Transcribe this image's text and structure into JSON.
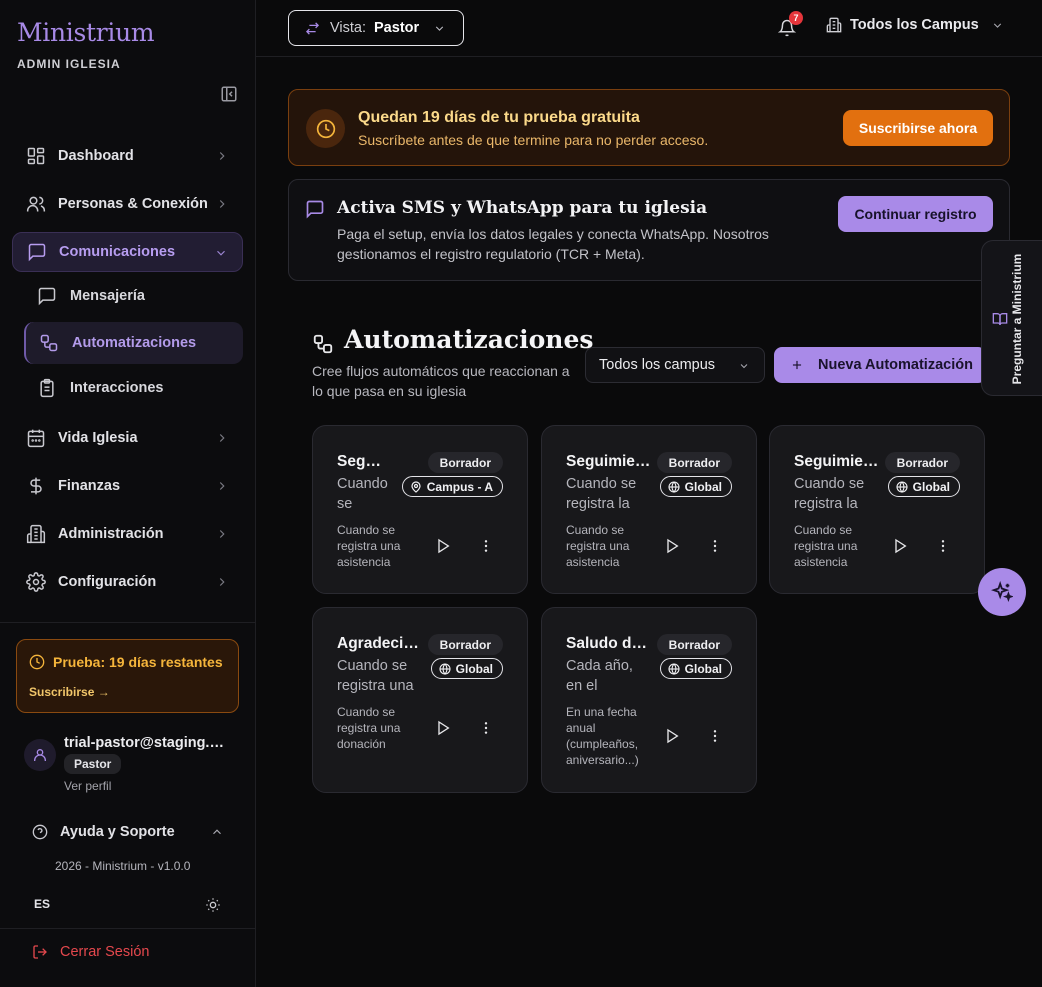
{
  "sidebar": {
    "brand": "Ministrium",
    "brand_sub": "ADMIN IGLESIA",
    "items": [
      {
        "label": "Dashboard"
      },
      {
        "label": "Personas & Conexión"
      },
      {
        "label": "Comunicaciones"
      },
      {
        "label": "Vida Iglesia"
      },
      {
        "label": "Finanzas"
      },
      {
        "label": "Administración"
      },
      {
        "label": "Configuración"
      }
    ],
    "sub_items": [
      {
        "label": "Mensajería"
      },
      {
        "label": "Automatizaciones"
      },
      {
        "label": "Interacciones"
      }
    ],
    "trial": {
      "title": "Prueba: 19 días restantes",
      "cta": "Suscribirse →"
    },
    "user": {
      "email": "trial-pastor@staging.ministrium.app",
      "role": "Pastor",
      "profile_link": "Ver perfil"
    },
    "help": {
      "label": "Ayuda y Soporte",
      "version": "2026 - Ministrium - v1.0.0"
    },
    "lang": "ES",
    "logout": "Cerrar Sesión"
  },
  "topbar": {
    "view_label": "Vista:",
    "view_value": "Pastor",
    "notifications": "7",
    "campus": "Todos los Campus"
  },
  "trial_banner": {
    "title": "Quedan 19 días de tu prueba gratuita",
    "subtitle": "Suscríbete antes de que termine para no perder acceso.",
    "cta": "Suscribirse ahora"
  },
  "sms_banner": {
    "title": "Activa SMS y WhatsApp para tu iglesia",
    "text": "Paga el setup, envía los datos legales y conecta WhatsApp. Nosotros gestionamos el registro regulatorio (TCR + Meta).",
    "cta": "Continuar registro"
  },
  "page": {
    "title": "Automatizaciones",
    "subtitle": "Cree flujos automáticos que reaccionan a lo que pasa en su iglesia",
    "campus_filter": "Todos los campus",
    "new_button": "Nueva Automatización"
  },
  "cards": [
    {
      "title": "Seguimiento de asistencia",
      "status": "Borrador",
      "scope": "Campus - A",
      "description": "Cuando se registra",
      "trigger": "Cuando se registra una asistencia"
    },
    {
      "title": "Seguimiento de asistencia",
      "status": "Borrador",
      "scope": "Global",
      "description": "Cuando se registra la asistencia",
      "trigger": "Cuando se registra una asistencia"
    },
    {
      "title": "Seguimiento de asistencia",
      "status": "Borrador",
      "scope": "Global",
      "description": "Cuando se registra la asistencia",
      "trigger": "Cuando se registra una asistencia"
    },
    {
      "title": "Agradecimiento por donación",
      "status": "Borrador",
      "scope": "Global",
      "description": "Cuando se registra una donación",
      "trigger": "Cuando se registra una donación"
    },
    {
      "title": "Saludo de cumpleaños",
      "status": "Borrador",
      "scope": "Global",
      "description": "Cada año, en el cumpleaños",
      "trigger": "En una fecha anual (cumpleaños, aniversario...)"
    }
  ],
  "assistant_tab": "Preguntar a Ministrium",
  "colors": {
    "accent": "#a98ae8",
    "warning": "#e2700f",
    "danger": "#e5484d"
  }
}
